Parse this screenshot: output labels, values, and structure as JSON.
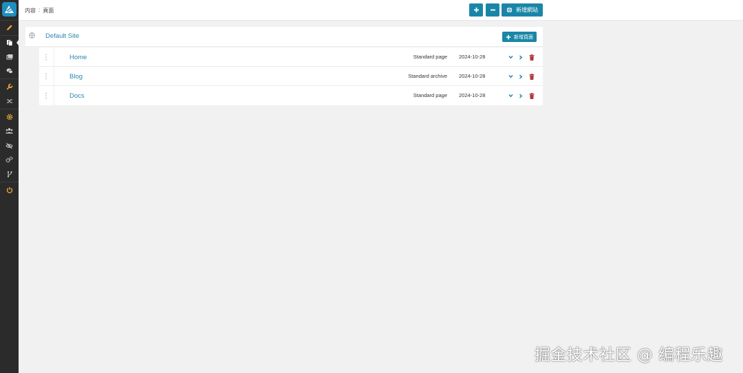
{
  "breadcrumb": {
    "section": "内容",
    "separator": ":",
    "page": "頁面"
  },
  "topbar": {
    "add_label": "+",
    "remove_label": "−",
    "new_site_label": "新增網站"
  },
  "site": {
    "name": "Default Site",
    "new_page_label": "新增頁面"
  },
  "pages": [
    {
      "title": "Home",
      "type": "Standard page",
      "date": "2024-10-28"
    },
    {
      "title": "Blog",
      "type": "Standard archive",
      "date": "2024-10-28"
    },
    {
      "title": "Docs",
      "type": "Standard page",
      "date": "2024-10-28"
    }
  ],
  "sidebar": {
    "items": [
      {
        "icon": "pencil-icon",
        "color": "#e8a33a"
      },
      {
        "icon": "pages-icon",
        "color": "#ffffff",
        "active": true
      },
      {
        "icon": "media-icon",
        "color": "#cfcfcf"
      },
      {
        "icon": "comments-icon",
        "color": "#cfcfcf"
      },
      {
        "icon": "wrench-icon",
        "color": "#e8a33a"
      },
      {
        "icon": "shuffle-icon",
        "color": "#cfcfcf"
      },
      {
        "icon": "gear-icon",
        "color": "#e8a33a"
      },
      {
        "icon": "users-icon",
        "color": "#cfcfcf"
      },
      {
        "icon": "eye-slash-icon",
        "color": "#cfcfcf"
      },
      {
        "icon": "cogs-icon",
        "color": "#cfcfcf"
      },
      {
        "icon": "branch-icon",
        "color": "#cfcfcf"
      },
      {
        "icon": "power-icon",
        "color": "#e8a33a"
      }
    ]
  },
  "watermark": "掘金技术社区 @ 编程乐趣",
  "colors": {
    "accent": "#1a86a7",
    "link": "#2a86ad",
    "delete": "#b03a3a",
    "sidebar_bg": "#2b2b2b",
    "highlight": "#e8a33a"
  }
}
